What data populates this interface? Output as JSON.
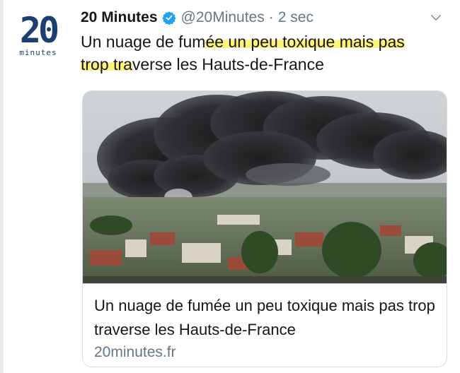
{
  "author": {
    "avatar_text": "20",
    "avatar_subtext": "minutes",
    "display_name": "20 Minutes",
    "handle": "@20Minutes",
    "separator": "·",
    "time": "2 sec",
    "verified": true
  },
  "tweet": {
    "text_before": "Un nuage de fum",
    "text_highlight_1": "ée un peu toxique mais pas",
    "text_line_break": "",
    "text_highlight_2": "trop tra",
    "text_after": "verse les Hauts-de-France"
  },
  "card": {
    "title": "Un nuage de fumée un peu toxique mais pas trop traverse les Hauts-de-France",
    "domain": "20minutes.fr"
  },
  "colors": {
    "brand": "#1b3f73",
    "verified": "#1da1f2",
    "secondary_text": "#657786",
    "highlight": "#fff27a"
  }
}
